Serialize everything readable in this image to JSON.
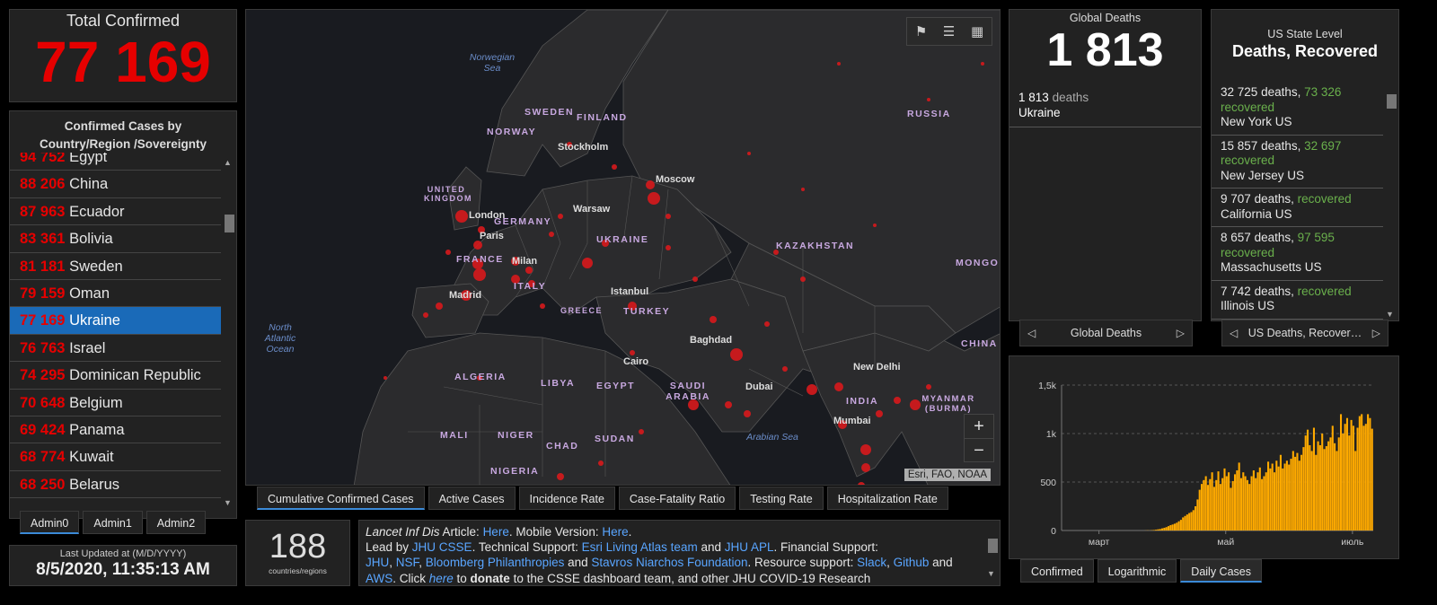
{
  "total": {
    "label": "Total Confirmed",
    "value": "77 169"
  },
  "countries": {
    "header": "Confirmed Cases by Country/Region /Sovereignty",
    "rows": [
      {
        "value": "94 752",
        "name": "Egypt"
      },
      {
        "value": "88 206",
        "name": "China"
      },
      {
        "value": "87 963",
        "name": "Ecuador"
      },
      {
        "value": "83 361",
        "name": "Bolivia"
      },
      {
        "value": "81 181",
        "name": "Sweden"
      },
      {
        "value": "79 159",
        "name": "Oman"
      },
      {
        "value": "77 169",
        "name": "Ukraine",
        "selected": true
      },
      {
        "value": "76 763",
        "name": "Israel"
      },
      {
        "value": "74 295",
        "name": "Dominican Republic"
      },
      {
        "value": "70 648",
        "name": "Belgium"
      },
      {
        "value": "69 424",
        "name": "Panama"
      },
      {
        "value": "68 774",
        "name": "Kuwait"
      },
      {
        "value": "68 250",
        "name": "Belarus"
      }
    ]
  },
  "admin_tabs": [
    "Admin0",
    "Admin1",
    "Admin2"
  ],
  "updated": {
    "label": "Last Updated at (M/D/YYYY)",
    "value": "8/5/2020, 11:35:13 AM"
  },
  "map": {
    "attribution": "Esri, FAO, NOAA",
    "toolbar_icons": [
      "bookmark-icon",
      "legend-list-icon",
      "basemap-grid-icon"
    ],
    "zoom_in": "+",
    "zoom_out": "−",
    "country_labels": [
      "SWEDEN",
      "FINLAND",
      "NORWAY",
      "UNITED KINGDOM",
      "GERMANY",
      "FRANCE",
      "ITALY",
      "GREECE",
      "UKRAINE",
      "TURKEY",
      "KAZAKHSTAN",
      "RUSSIA",
      "MONGO",
      "ALGERIA",
      "LIBYA",
      "EGYPT",
      "SAUDI ARABIA",
      "MALI",
      "NIGER",
      "CHAD",
      "SUDAN",
      "NIGERIA",
      "INDIA",
      "MYANMAR (BURMA)",
      "CHINA"
    ],
    "sea_labels": [
      "Norwegian Sea",
      "North Atlantic Ocean",
      "Arabian Sea"
    ],
    "city_labels": [
      "Stockholm",
      "Moscow",
      "London",
      "Warsaw",
      "Paris",
      "Milan",
      "Madrid",
      "Istanbul",
      "Baghdad",
      "Cairo",
      "Dubai",
      "New Delhi",
      "Mumbai"
    ]
  },
  "map_tabs": [
    "Cumulative Confirmed Cases",
    "Active Cases",
    "Incidence Rate",
    "Case-Fatality Ratio",
    "Testing Rate",
    "Hospitalization Rate"
  ],
  "country_count": {
    "value": "188",
    "label": "countries/regions"
  },
  "info": {
    "t1": "Lancet Inf Dis",
    "t2": " Article: ",
    "l1": "Here",
    "t3": ". Mobile Version: ",
    "l2": "Here",
    "t4": ".",
    "t5": "Lead by ",
    "l3": "JHU CSSE",
    "t6": ". Technical Support: ",
    "l4": "Esri Living Atlas team",
    "t7": " and ",
    "l5": "JHU APL",
    "t8": ". Financial Support:",
    "l6": "JHU",
    "t9": ", ",
    "l7": "NSF",
    "t10": ", ",
    "l8": "Bloomberg Philanthropies",
    "t11": " and ",
    "l9": "Stavros Niarchos Foundation",
    "t12": ". Resource support: ",
    "l10": "Slack",
    "t13": ", ",
    "l11": "Github",
    "t14": " and",
    "l12": "AWS",
    "t15": ". Click ",
    "l13": "here",
    "t16": " to ",
    "t17": "donate",
    "t18": " to the CSSE dashboard team, and other JHU COVID-19 Research"
  },
  "global_deaths": {
    "label": "Global Deaths",
    "value": "1 813",
    "item_value": "1 813",
    "item_unit": "deaths",
    "item_place": "Ukraine",
    "pager_label": "Global Deaths"
  },
  "us_state": {
    "label": "US State Level",
    "title": "Deaths, Recovered",
    "deaths_word": "deaths,",
    "recovered_word": "recovered",
    "rows": [
      {
        "deaths": "32 725",
        "recovered": "73 326",
        "place": "New York US"
      },
      {
        "deaths": "15 857",
        "recovered": "32 697",
        "place": "New Jersey US"
      },
      {
        "deaths": "9 707",
        "recovered": "",
        "place": "California US"
      },
      {
        "deaths": "8 657",
        "recovered": "97 595",
        "place": "Massachusetts US"
      },
      {
        "deaths": "7 742",
        "recovered": "",
        "place": "Illinois US"
      }
    ],
    "pager_label": "US Deaths, Recover…"
  },
  "chart_tabs": [
    "Confirmed",
    "Logarithmic",
    "Daily Cases"
  ],
  "chart_data": {
    "type": "bar",
    "title": "",
    "xlabel": "",
    "ylabel": "",
    "ylim": [
      0,
      1500
    ],
    "yticks": [
      0,
      500,
      1000,
      1500
    ],
    "ytick_labels": [
      "0",
      "500",
      "1k",
      "1,5k"
    ],
    "xtick_labels": [
      "март",
      "май",
      "июль"
    ],
    "xtick_day_index": [
      18,
      79,
      140
    ],
    "color": "#ffaa00",
    "values": [
      0,
      0,
      0,
      0,
      0,
      0,
      0,
      0,
      0,
      0,
      0,
      0,
      0,
      0,
      0,
      0,
      0,
      0,
      0,
      0,
      0,
      0,
      0,
      0,
      0,
      0,
      0,
      0,
      0,
      0,
      0,
      0,
      0,
      0,
      0,
      0,
      0,
      0,
      0,
      0,
      1,
      2,
      1,
      3,
      5,
      8,
      12,
      15,
      22,
      28,
      35,
      45,
      55,
      62,
      70,
      80,
      95,
      110,
      135,
      150,
      165,
      180,
      190,
      210,
      250,
      320,
      420,
      480,
      520,
      560,
      470,
      530,
      600,
      450,
      520,
      610,
      480,
      540,
      640,
      560,
      600,
      440,
      510,
      580,
      620,
      700,
      540,
      600,
      560,
      520,
      480,
      560,
      620,
      540,
      600,
      650,
      530,
      560,
      600,
      710,
      640,
      690,
      600,
      720,
      660,
      780,
      640,
      690,
      720,
      680,
      740,
      820,
      760,
      800,
      720,
      780,
      860,
      980,
      1040,
      880,
      820,
      1060,
      780,
      920,
      880,
      1000,
      840,
      870,
      920,
      960,
      1080,
      900,
      820,
      960,
      1200,
      1000,
      1100,
      1160,
      980,
      1140,
      1080,
      820,
      1060,
      1180,
      1200,
      1080,
      1100,
      1200,
      1160,
      1050
    ]
  }
}
